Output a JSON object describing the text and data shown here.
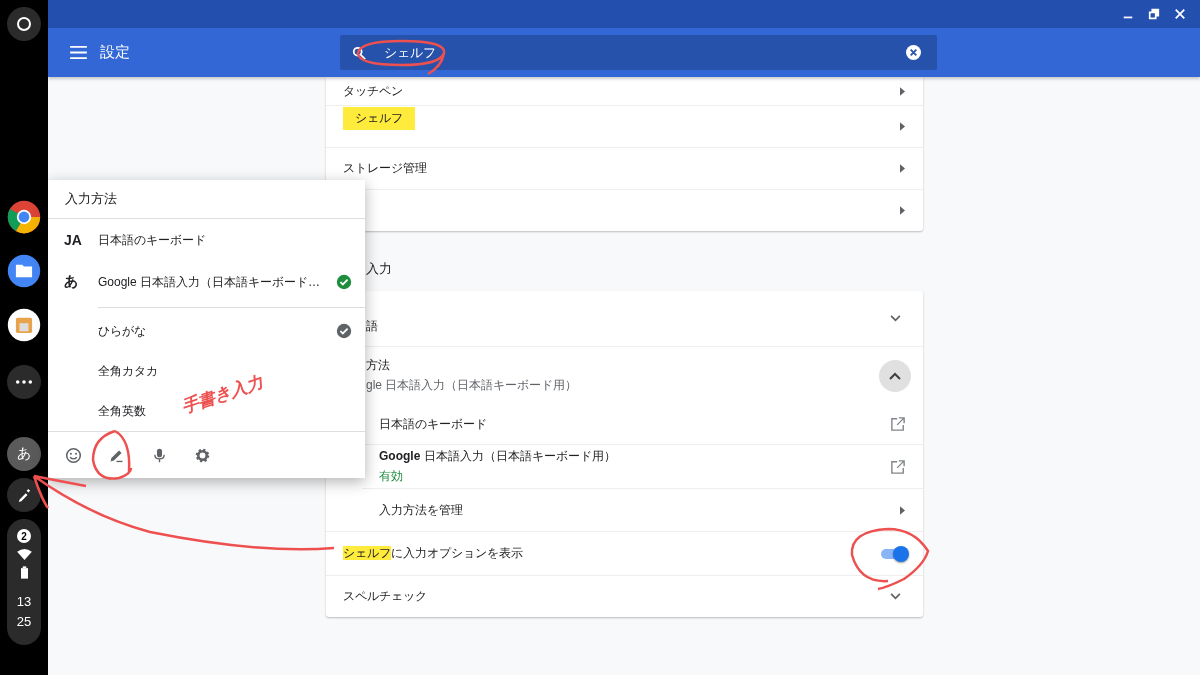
{
  "shelf": {
    "ime_button": "あ",
    "notification_count": "2",
    "time_hour": "13",
    "time_minute": "25"
  },
  "toolbar": {
    "title": "設定",
    "search_value": "シェルフ"
  },
  "tooltip": "シェルフ",
  "device_rows": [
    {
      "label": "タッチペン"
    },
    {
      "label": ""
    },
    {
      "label": "ストレージ管理"
    },
    {
      "label": ""
    }
  ],
  "section_title": "入力",
  "language_row": {
    "label": "語",
    "expanded": false
  },
  "input_method_row": {
    "label": "方法",
    "subtitle": "gle 日本語入力（日本語キーボード用）",
    "expanded": true
  },
  "input_methods": [
    {
      "label": "日本語のキーボード"
    },
    {
      "label": "**Google** 日本語入力（日本語キーボード用）",
      "status": "有効"
    }
  ],
  "manage_row": "入力方法を管理",
  "shelf_option": {
    "highlight": "シェルフ",
    "label": "に入力オプションを表示",
    "on": true
  },
  "spellcheck": {
    "label": "スペルチェック",
    "expanded": false
  },
  "ime_menu": {
    "title": "入力方法",
    "ime_list": [
      {
        "badge": "JA",
        "label": "日本語のキーボード",
        "selected": false
      },
      {
        "badge": "あ",
        "label": "Google 日本語入力（日本語キーボード…",
        "selected": true
      }
    ],
    "modes": [
      {
        "label": "ひらがな",
        "selected": true
      },
      {
        "label": "全角カタカ",
        "selected": false
      },
      {
        "label": "全角英数",
        "selected": false
      }
    ]
  },
  "annotation": "手書き入力"
}
